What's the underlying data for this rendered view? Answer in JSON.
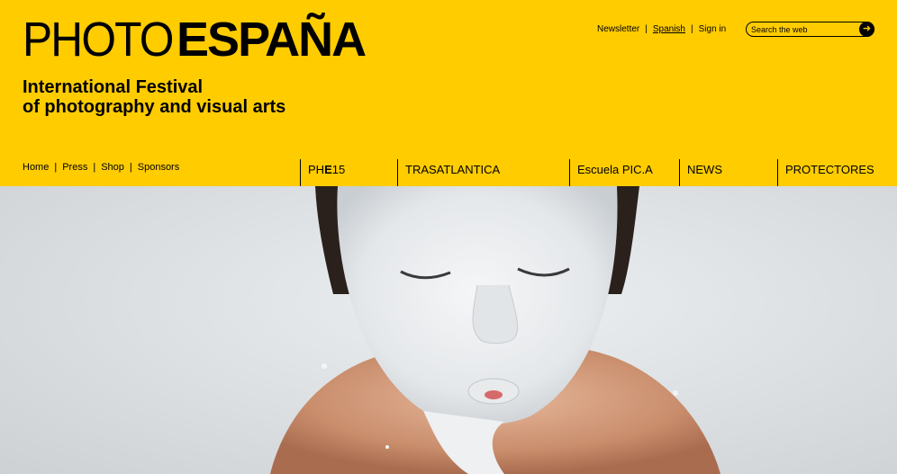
{
  "brand": {
    "logo_light": "PHOTO",
    "logo_bold": "ESPAÑA"
  },
  "tagline": {
    "line1": "International Festival",
    "line2": "of photography and visual arts"
  },
  "utility": {
    "newsletter": "Newsletter",
    "spanish": "Spanish",
    "sign_in": "Sign in",
    "separator": "|"
  },
  "search": {
    "placeholder": "Search the web",
    "go_icon": "arrow-right-icon"
  },
  "subnav": {
    "home": "Home",
    "press": "Press",
    "shop": "Shop",
    "sponsors": "Sponsors",
    "separator": "|"
  },
  "mainnav": [
    {
      "label_pre": "PH",
      "label_bold": "E",
      "label_post": "15"
    },
    {
      "label": "TRASATLANTICA"
    },
    {
      "label": "Escuela PIC.A"
    },
    {
      "label": "NEWS"
    },
    {
      "label": "PROTECTORES"
    }
  ],
  "colors": {
    "brand_yellow": "#ffcc00",
    "text": "#000000"
  }
}
